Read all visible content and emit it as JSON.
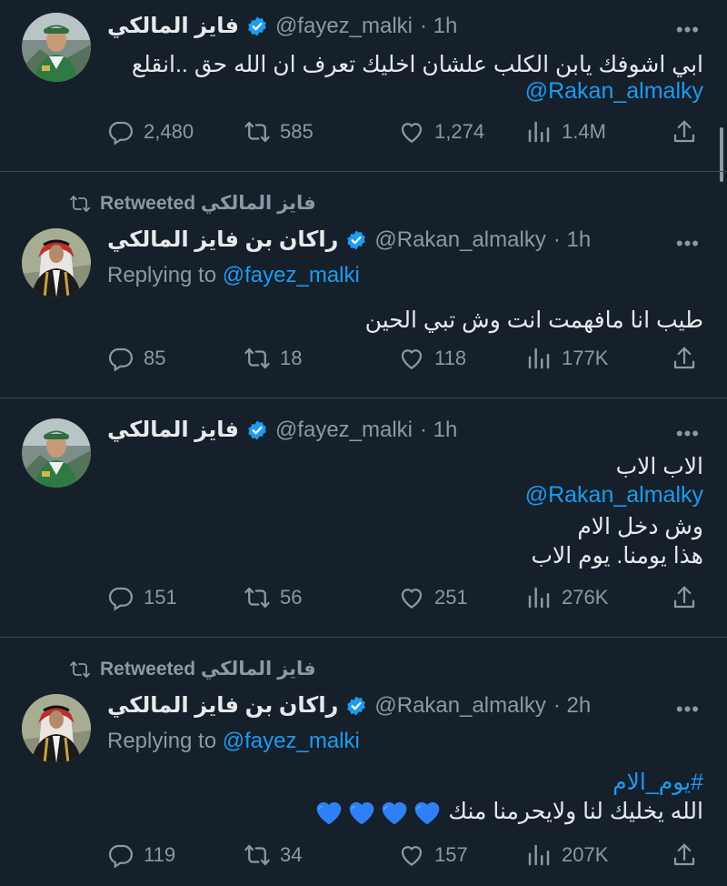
{
  "accent": "#1d9bf0",
  "tweets": [
    {
      "retweeted_by": null,
      "display_name": "فايز المالكي",
      "handle": "@fayez_malki",
      "time": "· 1h",
      "replying_to": null,
      "lines": [
        "ابي اشوفك يابن الكلب علشان اخليك تعرف ان الله حق ..انقلع"
      ],
      "mention_line": "@Rakan_almalky",
      "counts": {
        "replies": "2,480",
        "retweets": "585",
        "likes": "1,274",
        "views": "1.4M"
      }
    },
    {
      "retweeted_by": "فايز المالكي Retweeted",
      "display_name": "راكان بن فايز المالكي",
      "handle": "@Rakan_almalky",
      "time": "· 1h",
      "replying_label": "Replying to",
      "replying_to": "@fayez_malki",
      "lines": [
        "طيب انا مافهمت انت وش تبي الحين"
      ],
      "counts": {
        "replies": "85",
        "retweets": "18",
        "likes": "118",
        "views": "177K"
      }
    },
    {
      "retweeted_by": null,
      "display_name": "فايز المالكي",
      "handle": "@fayez_malki",
      "time": "· 1h",
      "replying_to": null,
      "line1": "الاب الاب",
      "mention_line": "@Rakan_almalky",
      "line2": "وش دخل الام",
      "line3": "هذا يومنا. يوم الاب",
      "counts": {
        "replies": "151",
        "retweets": "56",
        "likes": "251",
        "views": "276K"
      }
    },
    {
      "retweeted_by": "فايز المالكي Retweeted",
      "display_name": "راكان بن فايز المالكي",
      "handle": "@Rakan_almalky",
      "time": "· 2h",
      "replying_label": "Replying to",
      "replying_to": "@fayez_malki",
      "hashtag": "#يوم_الام",
      "line1": "الله يخليك لنا ولايحرمنا منك",
      "emoji": "blue-heart x4",
      "counts": {
        "replies": "119",
        "retweets": "34",
        "likes": "157",
        "views": "207K"
      }
    }
  ],
  "more_label": "•••"
}
